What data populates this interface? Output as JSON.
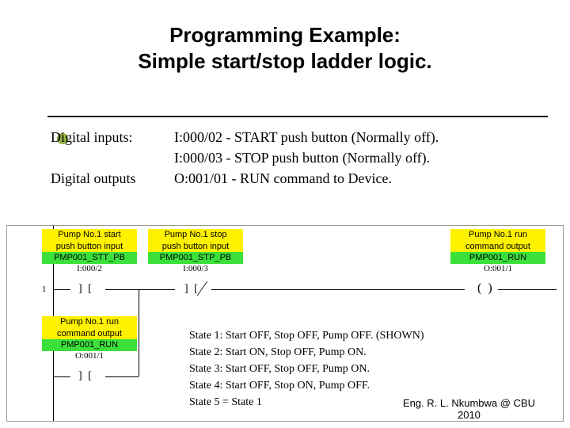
{
  "title_l1": "Programming Example:",
  "title_l2": "Simple start/stop ladder logic.",
  "io": {
    "di_label": "Digital inputs:",
    "di1": "I:000/02 - START push button (Normally off).",
    "di2": "I:000/03 - STOP push button (Normally off).",
    "do_label": "Digital outputs",
    "do1": "O:001/01 - RUN command to Device."
  },
  "tags": {
    "start": {
      "desc1": "Pump No.1 start",
      "desc2": "push button input",
      "tag": "PMP001_STT_PB",
      "addr": "I:000/2"
    },
    "stop": {
      "desc1": "Pump No.1 stop",
      "desc2": "push button input",
      "tag": "PMP001_STP_PB",
      "addr": "I:000/3"
    },
    "run_out": {
      "desc1": "Pump No.1 run",
      "desc2": "command output",
      "tag": "PMP001_RUN",
      "addr": "O:001/1"
    },
    "run_seal": {
      "desc1": "Pump No.1 run",
      "desc2": "command output",
      "tag": "PMP001_RUN",
      "addr": "O:001/1"
    }
  },
  "rung_number": "1",
  "states": {
    "s1": "State 1: Start OFF, Stop OFF, Pump OFF. (SHOWN)",
    "s2": "State 2: Start ON, Stop OFF, Pump ON.",
    "s3": "State 3: Start OFF, Stop OFF, Pump ON.",
    "s4": "State 4: Start OFF, Stop ON, Pump OFF.",
    "s5": "State 5 = State 1"
  },
  "footer_l1": "Eng. R. L. Nkumbwa @ CBU",
  "footer_l2": "2010"
}
